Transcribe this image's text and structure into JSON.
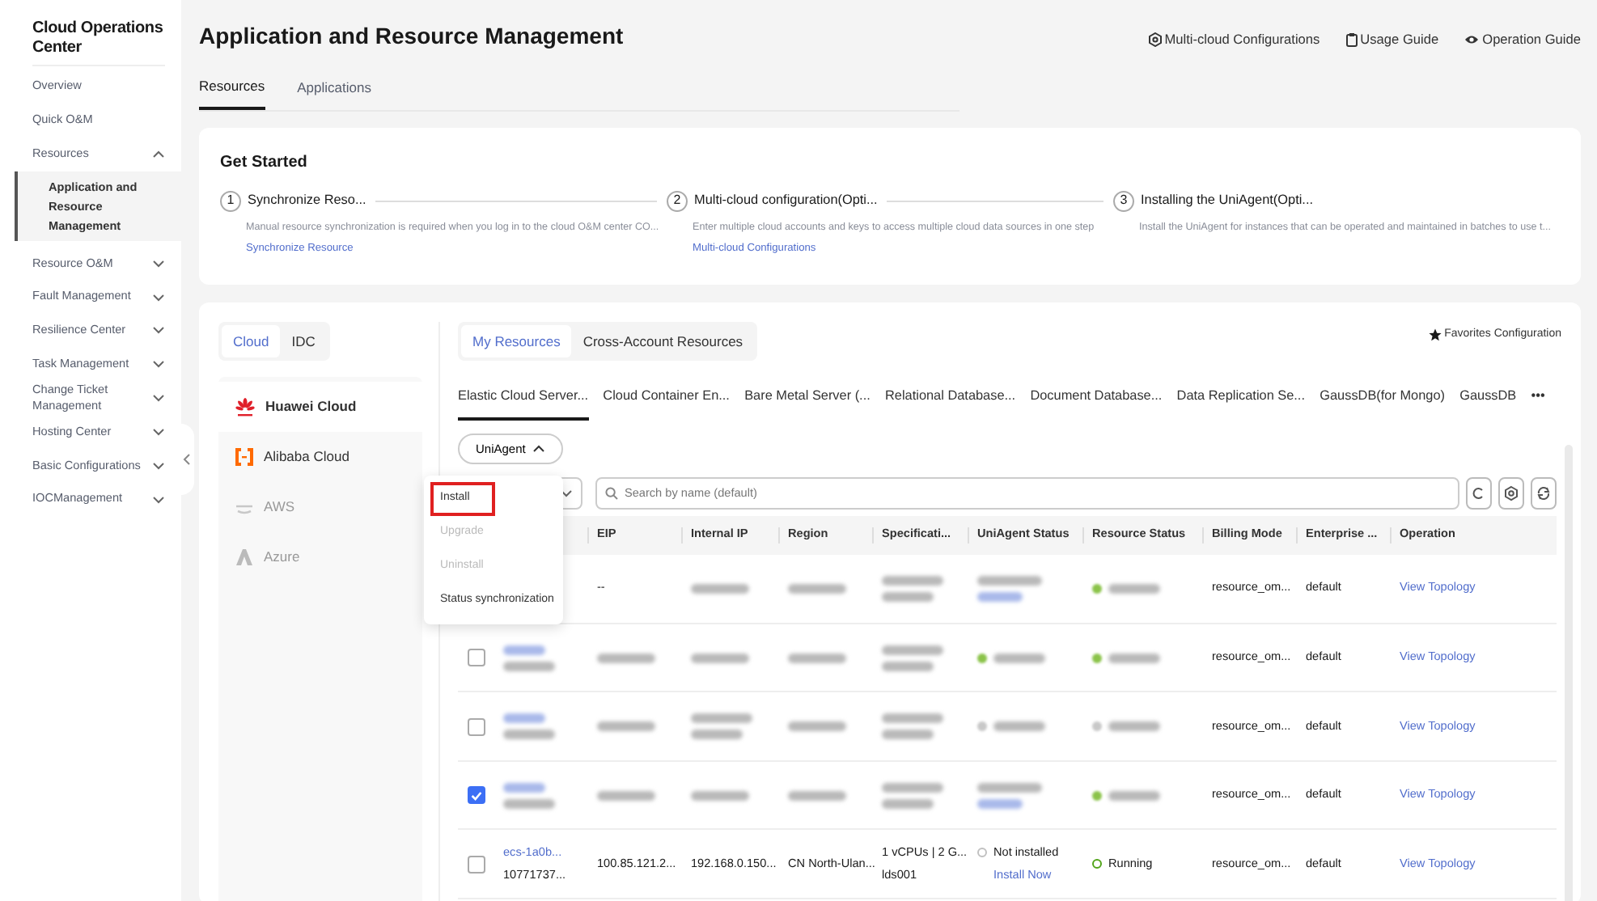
{
  "sidebar": {
    "title": "Cloud Operations Center",
    "items": [
      {
        "label": "Overview"
      },
      {
        "label": "Quick O&M"
      },
      {
        "label": "Resources",
        "expanded": true,
        "children": [
          {
            "label": "Application and Resource Management",
            "selected": true
          }
        ]
      },
      {
        "label": "Resource O&M",
        "expanded": false
      },
      {
        "label": "Fault Management",
        "expanded": false
      },
      {
        "label": "Resilience Center",
        "expanded": false
      },
      {
        "label": "Task Management",
        "expanded": false
      },
      {
        "label": "Change Ticket Management",
        "expanded": false
      },
      {
        "label": "Hosting Center",
        "expanded": false
      },
      {
        "label": "Basic Configurations",
        "expanded": false
      },
      {
        "label": "IOCManagement",
        "expanded": false
      }
    ]
  },
  "header": {
    "title": "Application and Resource Management",
    "links": [
      "Multi-cloud Configurations",
      "Usage Guide",
      "Operation Guide"
    ],
    "tabs": [
      {
        "label": "Resources",
        "selected": true
      },
      {
        "label": "Applications",
        "selected": false
      }
    ]
  },
  "get_started": {
    "title": "Get Started",
    "steps": [
      {
        "number": "1",
        "title": "Synchronize Reso...",
        "description": "Manual resource synchronization is required when you log in to the cloud O&M center CO...",
        "link": "Synchronize Resource"
      },
      {
        "number": "2",
        "title": "Multi-cloud configuration(Opti...",
        "description": "Enter multiple cloud accounts and keys to access multiple cloud data sources in one step",
        "link": "Multi-cloud Configurations"
      },
      {
        "number": "3",
        "title": "Installing the UniAgent(Opti...",
        "description": "Install the UniAgent for instances that can be operated and maintained in batches to use t..."
      }
    ]
  },
  "source_toggle": [
    {
      "label": "Cloud",
      "selected": true
    },
    {
      "label": "IDC",
      "selected": false
    }
  ],
  "providers": [
    {
      "label": "Huawei Cloud",
      "selected": true,
      "disabled": false
    },
    {
      "label": "Alibaba Cloud",
      "selected": false,
      "disabled": false
    },
    {
      "label": "AWS",
      "selected": false,
      "disabled": true
    },
    {
      "label": "Azure",
      "selected": false,
      "disabled": true
    }
  ],
  "resource_scope": [
    {
      "label": "My Resources",
      "selected": true
    },
    {
      "label": "Cross-Account Resources",
      "selected": false
    }
  ],
  "favorites_link": "Favorites Configuration",
  "categories": [
    {
      "label": "Elastic Cloud Server...",
      "selected": true
    },
    {
      "label": "Cloud Container En...",
      "selected": false
    },
    {
      "label": "Bare Metal Server (...",
      "selected": false
    },
    {
      "label": "Relational Database...",
      "selected": false
    },
    {
      "label": "Document Database...",
      "selected": false
    },
    {
      "label": "Data Replication Se...",
      "selected": false
    },
    {
      "label": "GaussDB(for Mongo)",
      "selected": false
    },
    {
      "label": "GaussDB",
      "selected": false
    }
  ],
  "more": "•••",
  "uniagent_button": {
    "label": "UniAgent",
    "expanded": true
  },
  "uniagent_menu": [
    {
      "label": "Install",
      "disabled": false,
      "highlighted": true
    },
    {
      "label": "Upgrade",
      "disabled": true,
      "highlighted": false
    },
    {
      "label": "Uninstall",
      "disabled": true,
      "highlighted": false
    },
    {
      "label": "Status synchronization",
      "disabled": false,
      "highlighted": false
    }
  ],
  "search": {
    "placeholder": "Search by name (default)"
  },
  "table": {
    "columns": [
      "",
      "",
      "EIP",
      "Internal IP",
      "Region",
      "Specificati...",
      "UniAgent Status",
      "Resource Status",
      "Billing Mode",
      "Enterprise ...",
      "Operation"
    ],
    "rows": [
      {
        "cells": [
          {
            "kind": "empty"
          },
          {
            "kind": "empty"
          },
          {
            "kind": "text",
            "text": "--"
          },
          {
            "kind": "blur"
          },
          {
            "kind": "blur"
          },
          {
            "kind": "blur2"
          },
          {
            "kind": "blur-agent"
          },
          {
            "kind": "blur-status",
            "color": "#8bc34a"
          },
          {
            "kind": "text",
            "text": "resource_om..."
          },
          {
            "kind": "text",
            "text": "default"
          },
          {
            "kind": "link",
            "text": "View Topology"
          }
        ]
      },
      {
        "cells": [
          {
            "kind": "checkbox",
            "checked": false
          },
          {
            "kind": "blur-name"
          },
          {
            "kind": "blur"
          },
          {
            "kind": "blur"
          },
          {
            "kind": "blur"
          },
          {
            "kind": "blur2"
          },
          {
            "kind": "blur-status",
            "color": "#8bc34a"
          },
          {
            "kind": "blur-status",
            "color": "#8bc34a"
          },
          {
            "kind": "text",
            "text": "resource_om..."
          },
          {
            "kind": "text",
            "text": "default"
          },
          {
            "kind": "link",
            "text": "View Topology"
          }
        ]
      },
      {
        "cells": [
          {
            "kind": "checkbox",
            "checked": false
          },
          {
            "kind": "blur-name"
          },
          {
            "kind": "blur"
          },
          {
            "kind": "blur2"
          },
          {
            "kind": "blur"
          },
          {
            "kind": "blur2"
          },
          {
            "kind": "blur-status",
            "color": "#c8c8c8"
          },
          {
            "kind": "blur-status",
            "color": "#c8c8c8"
          },
          {
            "kind": "text",
            "text": "resource_om..."
          },
          {
            "kind": "text",
            "text": "default"
          },
          {
            "kind": "link",
            "text": "View Topology"
          }
        ]
      },
      {
        "cells": [
          {
            "kind": "checkbox",
            "checked": true
          },
          {
            "kind": "blur-name"
          },
          {
            "kind": "blur"
          },
          {
            "kind": "blur"
          },
          {
            "kind": "blur"
          },
          {
            "kind": "blur2"
          },
          {
            "kind": "blur-agent"
          },
          {
            "kind": "blur-status",
            "color": "#8bc34a"
          },
          {
            "kind": "text",
            "text": "resource_om..."
          },
          {
            "kind": "text",
            "text": "default"
          },
          {
            "kind": "link",
            "text": "View Topology"
          }
        ]
      },
      {
        "cells": [
          {
            "kind": "checkbox",
            "checked": false
          },
          {
            "kind": "name",
            "link": "ecs-1a0b...",
            "sub": "10771737..."
          },
          {
            "kind": "text",
            "text": "100.85.121.2..."
          },
          {
            "kind": "text",
            "text": "192.168.0.150..."
          },
          {
            "kind": "text",
            "text": "CN North-Ulan..."
          },
          {
            "kind": "lines",
            "lines": [
              "1 vCPUs | 2 G...",
              "lds001"
            ]
          },
          {
            "kind": "agent",
            "status": "Not installed",
            "link": "Install Now",
            "color": "#c0c0c0"
          },
          {
            "kind": "status",
            "text": "Running",
            "color": "#52a41a"
          },
          {
            "kind": "text",
            "text": "resource_om..."
          },
          {
            "kind": "text",
            "text": "default"
          },
          {
            "kind": "link",
            "text": "View Topology"
          }
        ]
      }
    ]
  }
}
